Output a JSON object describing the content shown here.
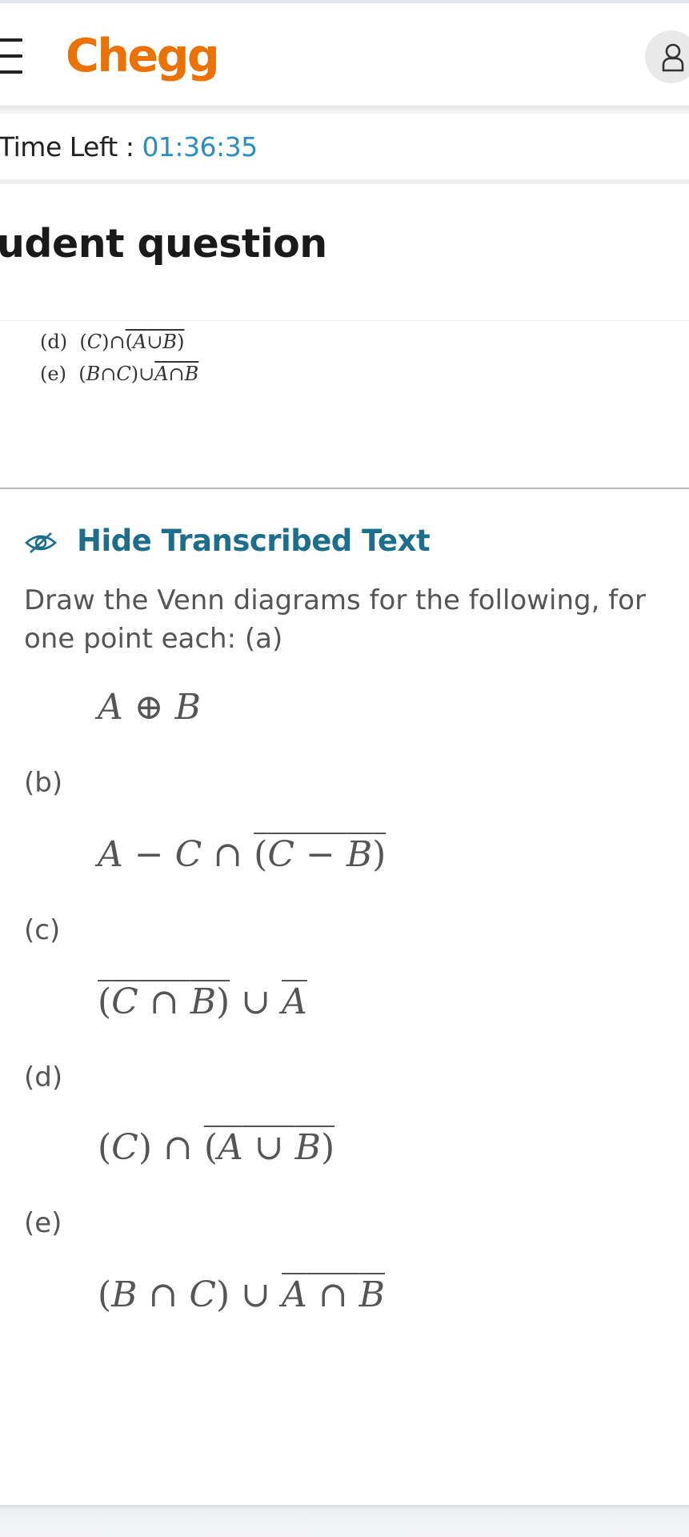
{
  "header": {
    "logo_text": "Chegg",
    "brand_color": "#eb7100",
    "menu_icon": "hamburger-menu-icon",
    "avatar_icon": "user-icon"
  },
  "timer": {
    "label": "Time Left : ",
    "value": "01:36:35"
  },
  "page": {
    "title": "udent question"
  },
  "image_preview": {
    "line_d_label": "(d)",
    "line_d_expr": "(C)∩(A∪B)",
    "line_e_label": "(e)",
    "line_e_expr": "(B∩C)∪A∩B"
  },
  "transcription": {
    "toggle_label": "Hide Transcribed Text",
    "toggle_icon": "eye-off-icon",
    "intro": "Draw the Venn diagrams for the following, for one point each: (a)",
    "parts": [
      {
        "label": "(b)"
      },
      {
        "label": "(c)"
      },
      {
        "label": "(d)"
      },
      {
        "label": "(e)"
      }
    ]
  }
}
